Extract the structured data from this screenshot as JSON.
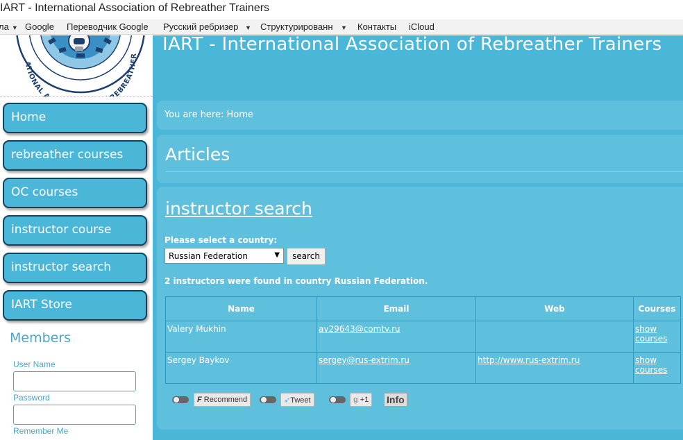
{
  "window": {
    "title": "IART - International Association of Rebreather Trainers"
  },
  "bookmarks": [
    {
      "label": "ла",
      "has_menu": true
    },
    {
      "label": "Google",
      "has_menu": false
    },
    {
      "label": "Переводчик Google",
      "has_menu": false
    },
    {
      "label": "Русский ребризер",
      "has_menu": true
    },
    {
      "label": "Структурированн",
      "has_menu": true
    },
    {
      "label": "Контакты",
      "has_menu": false
    },
    {
      "label": "iCloud",
      "has_menu": false
    }
  ],
  "site": {
    "title": "IART - International Association of Rebreather Trainers"
  },
  "nav": [
    {
      "label": "Home"
    },
    {
      "label": "rebreather courses"
    },
    {
      "label": "OC courses"
    },
    {
      "label": "instructor course"
    },
    {
      "label": "instructor search"
    },
    {
      "label": "IART Store"
    }
  ],
  "members": {
    "title": "Members",
    "username_label": "User Name",
    "password_label": "Password",
    "remember_label": "Remember Me"
  },
  "breadcrumb": {
    "text": "You are here: Home"
  },
  "articles": {
    "title": "Articles"
  },
  "content": {
    "title": "instructor search",
    "select_label": "Please select a country:",
    "selected_country": "Russian Federation",
    "search_label": "search",
    "result_text": "2 instructors were found in country Russian Federation.",
    "table": {
      "headers": [
        "Name",
        "Email",
        "Web",
        "Courses"
      ],
      "rows": [
        {
          "name": "Valery Mukhin",
          "email": "av29643@comtv.ru",
          "web": "",
          "courses": "show courses"
        },
        {
          "name": "Sergey Baykov",
          "email": "sergey@rus-extrim.ru",
          "web": "http://www.rus-extrim.ru",
          "courses": "show courses"
        }
      ]
    }
  },
  "social": {
    "recommend_label": "Recommend",
    "tweet_label": "Tweet",
    "gplus_label": "+1",
    "info_label": "Info"
  },
  "colors": {
    "page_bg": "#4ab6d8",
    "box_bg": "#5fc0de",
    "nav_border": "#17415a",
    "members_text": "#4aa6c7"
  }
}
